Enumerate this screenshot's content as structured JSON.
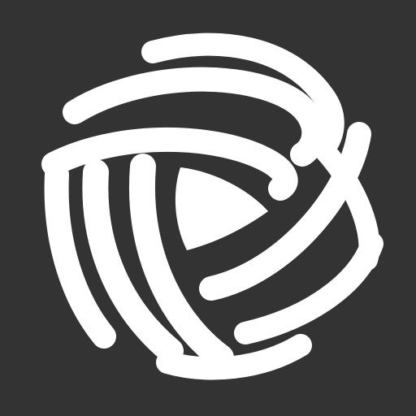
{
  "app_icon": {
    "icon": "yarn-ball-icon",
    "background_color": "#333333",
    "foreground_color": "#ffffff"
  }
}
